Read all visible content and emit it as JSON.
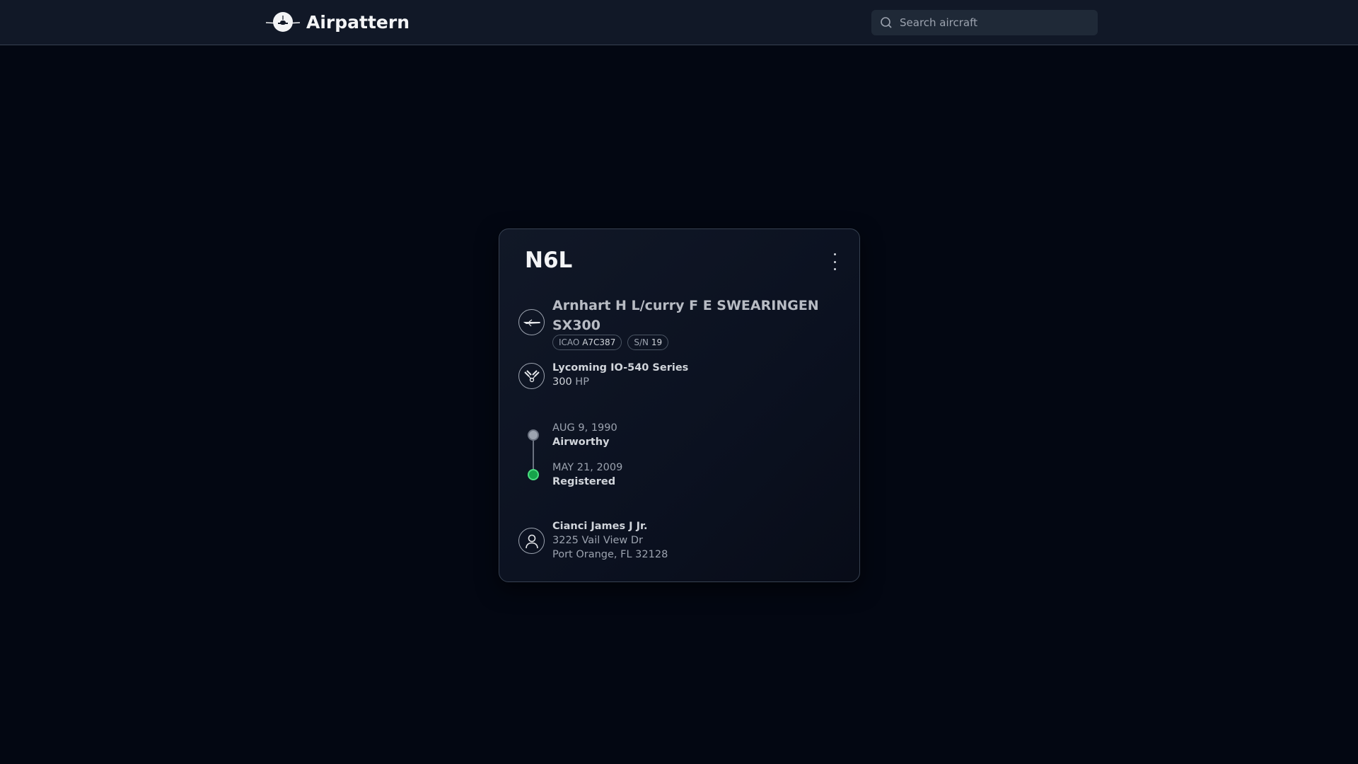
{
  "header": {
    "app_title": "Airpattern",
    "search_placeholder": "Search aircraft"
  },
  "aircraft": {
    "tail_number": "N6L",
    "model_line1": "Arnhart H L/curry F E SWEARINGEN",
    "model_line2": "SX300",
    "icao_label": "ICAO",
    "icao": "A7C387",
    "sn_label": "S/N",
    "sn": "19",
    "engine": "Lycoming IO-540 Series",
    "hp": "300",
    "hp_unit": "HP"
  },
  "timeline": [
    {
      "date": "AUG 9, 1990",
      "label": "Airworthy",
      "color": "#9ca3af"
    },
    {
      "date": "MAY 21, 2009",
      "label": "Registered",
      "color": "#16a34a"
    }
  ],
  "owner": {
    "name": "Cianci James J Jr.",
    "street": "3225 Vail View Dr",
    "city": "Port Orange, FL 32128"
  }
}
